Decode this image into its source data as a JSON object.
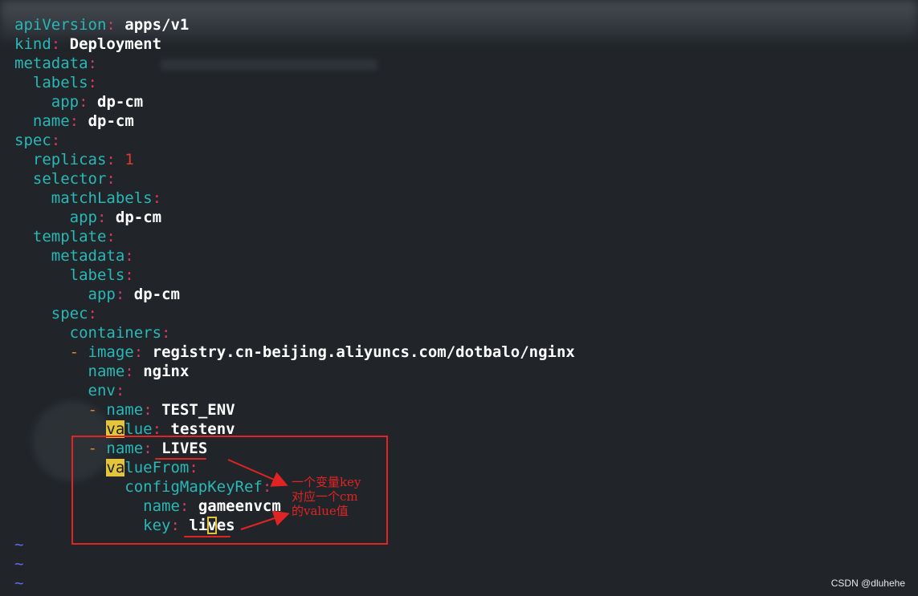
{
  "editor": {
    "lines": [
      {
        "k": "apiVersion",
        "v": "apps/v1"
      },
      {
        "k": "kind",
        "v": "Deployment"
      },
      {
        "k": "metadata",
        "v": ""
      },
      {
        "k": "labels",
        "v": ""
      },
      {
        "k": "app",
        "v": "dp-cm"
      },
      {
        "k": "name",
        "v": "dp-cm"
      },
      {
        "k": "spec",
        "v": ""
      },
      {
        "k": "replicas",
        "v": "1"
      },
      {
        "k": "selector",
        "v": ""
      },
      {
        "k": "matchLabels",
        "v": ""
      },
      {
        "k": "app",
        "v": "dp-cm"
      },
      {
        "k": "template",
        "v": ""
      },
      {
        "k": "metadata",
        "v": ""
      },
      {
        "k": "labels",
        "v": ""
      },
      {
        "k": "app",
        "v": "dp-cm"
      },
      {
        "k": "spec",
        "v": ""
      },
      {
        "k": "containers",
        "v": ""
      },
      {
        "k": "image",
        "v": "registry.cn-beijing.aliyuncs.com/dotbalo/nginx"
      },
      {
        "k": "name",
        "v": "nginx"
      },
      {
        "k": "env",
        "v": ""
      },
      {
        "k": "name",
        "v": "TEST_ENV"
      },
      {
        "k_hl": "va",
        "k_rest": "lue",
        "v": "testenv"
      },
      {
        "k": "name",
        "v": "LIVES"
      },
      {
        "k_hl": "va",
        "k_rest": "lueFrom",
        "v": ""
      },
      {
        "k": "configMapKeyRef",
        "v": ""
      },
      {
        "k": "name",
        "v": "gameenvcm"
      },
      {
        "k": "key",
        "v_a": "li",
        "v_cur": "v",
        "v_b": "es"
      }
    ],
    "tildes": [
      "~",
      "~",
      "~"
    ]
  },
  "annotation": {
    "line1": "一个变量key",
    "line2": "对应一个cm",
    "line3": "的value值"
  },
  "watermark": "CSDN @dluhehe",
  "colors": {
    "background": "#212529",
    "key": "#2ab7b7",
    "colon": "#d63a60",
    "number": "#e23a2b",
    "dash": "#e0862b",
    "highlight": "#e2c53a",
    "tilde": "#5e6cf0",
    "annotation_red": "#e02424"
  }
}
